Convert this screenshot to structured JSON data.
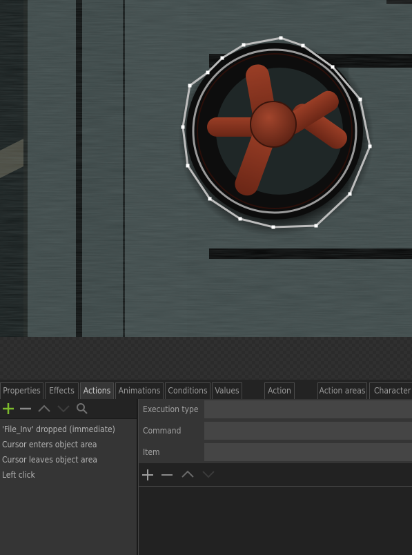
{
  "scene": {
    "description": "Game scene viewport showing a metal wall with a red valve wheel",
    "object_outline": {
      "label": "Object area polygon around valve wheel",
      "vertex_count": 16
    },
    "colors": {
      "wall": "#3e4a4a",
      "valve": "#8a3522",
      "outline": "#bdbdbd",
      "vertex": "#ffffff"
    }
  },
  "tabs": [
    {
      "label": "Properties",
      "active": false
    },
    {
      "label": "Effects",
      "active": false
    },
    {
      "label": "Actions",
      "active": true
    },
    {
      "label": "Animations",
      "active": false
    },
    {
      "label": "Conditions",
      "active": false
    },
    {
      "label": "Values",
      "active": false
    },
    {
      "label": "Action",
      "active": false
    },
    {
      "label": "Action areas",
      "active": false
    },
    {
      "label": "Character",
      "active": false
    }
  ],
  "left_toolbar": {
    "add": "plus-icon",
    "remove": "minus-icon",
    "up": "chevron-up-icon",
    "down": "chevron-down-icon",
    "search": "search-icon",
    "add_color": "#7dbb2c"
  },
  "events": [
    "'File_Inv' dropped (immediate)",
    "Cursor enters object area",
    "Cursor leaves object area",
    "Left click"
  ],
  "action_props": [
    {
      "label": "Execution type",
      "value": ""
    },
    {
      "label": "Command",
      "value": ""
    },
    {
      "label": "Item",
      "value": ""
    }
  ],
  "command_toolbar": {
    "add": "plus-icon",
    "remove": "minus-icon",
    "up": "chevron-up-icon",
    "down": "chevron-down-icon"
  }
}
